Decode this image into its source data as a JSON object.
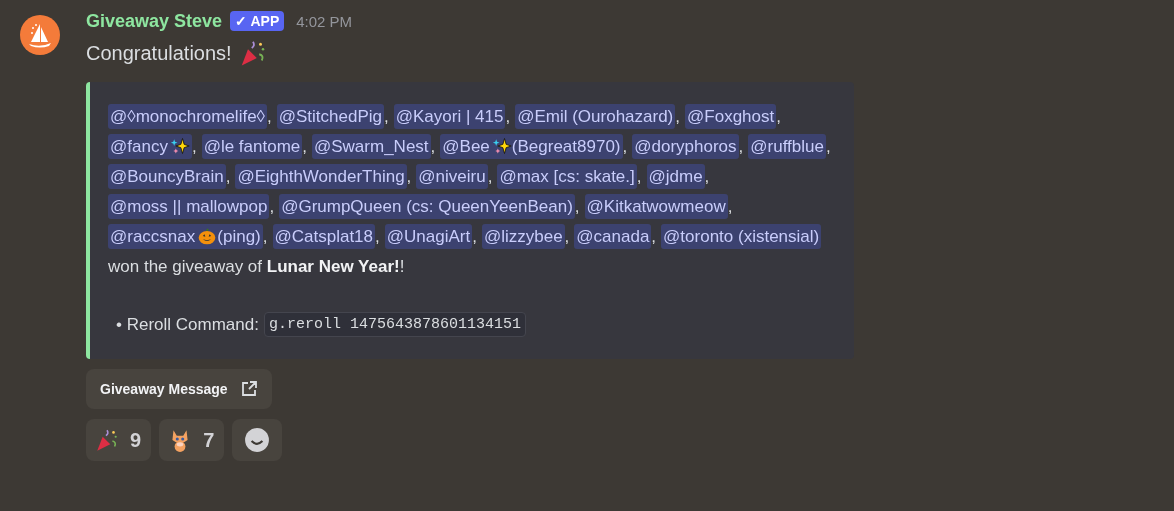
{
  "message": {
    "author": "Giveaway Steve",
    "badge": "APP",
    "badge_check": "✓",
    "time": "4:02 PM",
    "text": "Congratulations!"
  },
  "embed": {
    "winners": [
      {
        "text": "@◊monochromelife◊",
        "suffix": ","
      },
      {
        "text": "@StitchedPig",
        "suffix": ","
      },
      {
        "text": "@Kayori | 415",
        "suffix": ","
      },
      {
        "text": "@Emil (Ourohazard)",
        "suffix": ","
      },
      {
        "text": "@Foxghost",
        "suffix": ","
      },
      {
        "text": "@fancy",
        "emoji": {
          "kind": "sparkles"
        },
        "suffix": ","
      },
      {
        "text": "@le fantome",
        "suffix": ","
      },
      {
        "text": "@Swarm_Nest",
        "suffix": ","
      },
      {
        "text": "@Bee",
        "emoji": {
          "kind": "sparkles"
        },
        "after": "(Begreat8970)",
        "suffix": ","
      },
      {
        "text": "@doryphoros",
        "suffix": ","
      },
      {
        "text": "@ruffblue",
        "suffix": ","
      },
      {
        "text": "@BouncyBrain",
        "suffix": ","
      },
      {
        "text": "@EighthWonderThing",
        "suffix": ","
      },
      {
        "text": "@niveiru",
        "suffix": ","
      },
      {
        "text": "@max [cs: skate.]",
        "suffix": ","
      },
      {
        "text": "@jdme",
        "suffix": ","
      },
      {
        "text": "@moss || mallowpop",
        "suffix": ","
      },
      {
        "text": "@GrumpQueen (cs: QueenYeenBean)",
        "suffix": ","
      },
      {
        "text": "@Kitkatwowmeow",
        "suffix": ","
      },
      {
        "text": "@raccsnax",
        "emoji": {
          "kind": "pumpkin"
        },
        "after": "(ping)",
        "suffix": ","
      },
      {
        "text": "@Catsplat18",
        "suffix": ","
      },
      {
        "text": "@UnagiArt",
        "suffix": ","
      },
      {
        "text": "@lizzybee",
        "suffix": ","
      },
      {
        "text": "@canada",
        "suffix": ","
      },
      {
        "text": "@toronto (xistensial)"
      }
    ],
    "result_text": "won the giveaway of **Lunar New Year!**!",
    "bullet": "•",
    "reroll_label": "Reroll Command:",
    "reroll_command": "g.reroll 1475643878601134151"
  },
  "link_button": {
    "label": "Giveaway Message"
  },
  "reactions": [
    {
      "emoji": {
        "kind": "party"
      },
      "count": "9"
    },
    {
      "emoji": {
        "kind": "cat"
      },
      "count": "7"
    }
  ]
}
